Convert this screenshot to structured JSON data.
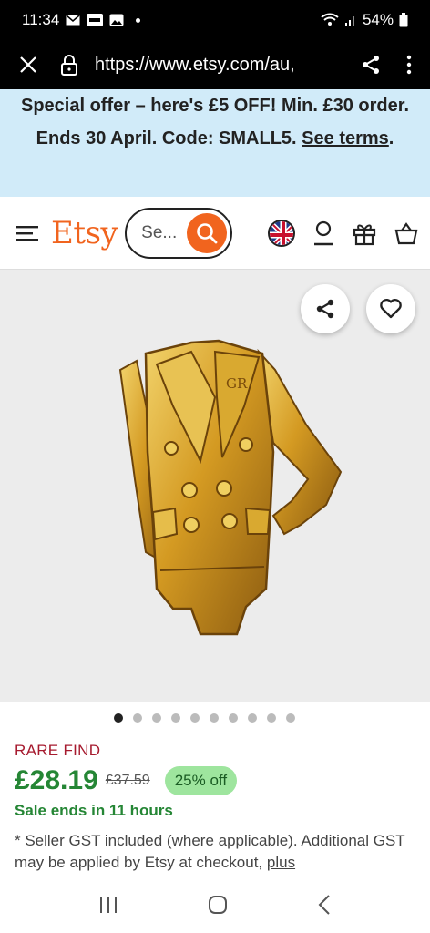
{
  "status": {
    "time": "11:34",
    "battery": "54%"
  },
  "browser": {
    "url": "https://www.etsy.com/au,"
  },
  "promo": {
    "text": "Special offer – here's £5 OFF! Min. £30 order. Ends 30 April. Code: SMALL5.",
    "link": "See terms"
  },
  "header": {
    "logo": "Etsy",
    "search_placeholder": "Se..."
  },
  "gallery": {
    "dot_count": 10,
    "active_index": 0
  },
  "product": {
    "rare_label": "RARE FIND",
    "price": "£28.19",
    "old_price": "£37.59",
    "discount": "25% off",
    "sale_ends": "Sale ends in 11 hours",
    "gst_note": "* Seller GST included (where applicable). Additional GST may be applied by Etsy at checkout,",
    "gst_more": "plus"
  },
  "colors": {
    "brand": "#f1641e",
    "promo_bg": "#d1ebf9",
    "price": "#258635",
    "rare": "#a61a2e",
    "badge_bg": "#9ee59e"
  }
}
